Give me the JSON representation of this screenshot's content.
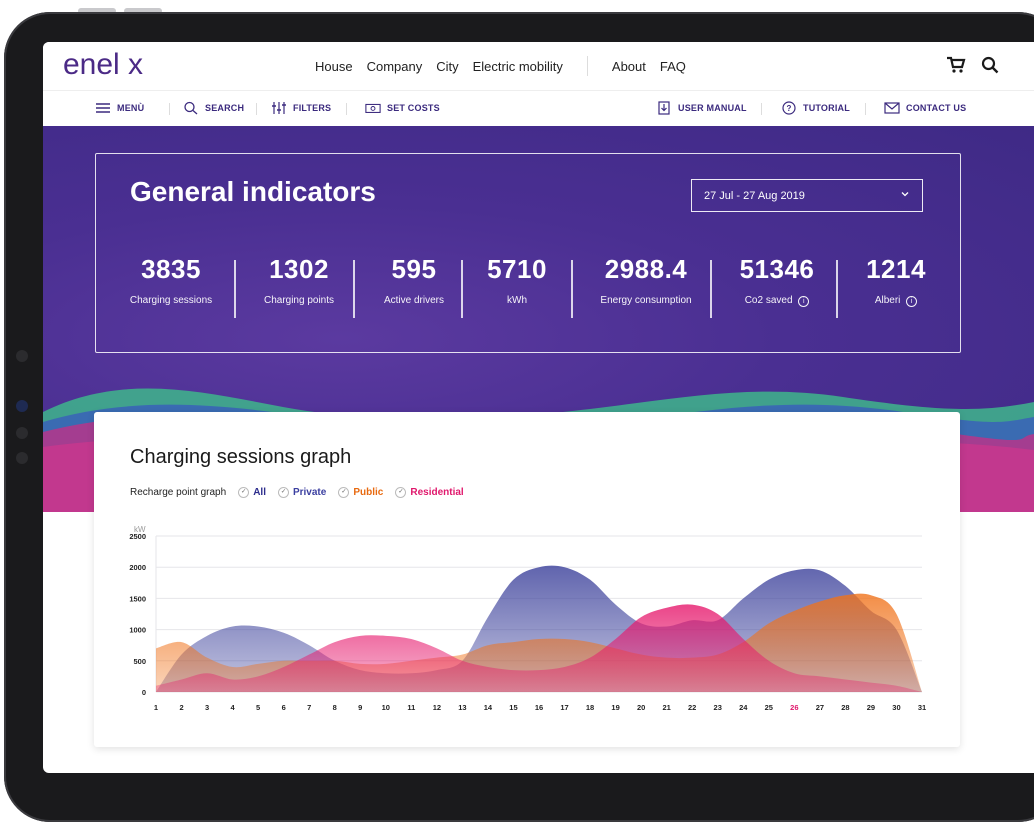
{
  "nav": {
    "logo": "enel x",
    "links": [
      "House",
      "Company",
      "City",
      "Electric mobility"
    ],
    "links2": [
      "About",
      "FAQ"
    ]
  },
  "toolbar": {
    "menu": "MENÙ",
    "search": "SEARCH",
    "filters": "FILTERS",
    "set_costs": "SET COSTS",
    "user_manual": "USER MANUAL",
    "tutorial": "TUTORIAL",
    "contact_us": "CONTACT US"
  },
  "indicators": {
    "title": "General indicators",
    "date_range": "27 Jul - 27 Aug 2019",
    "kpis": [
      {
        "value": "3835",
        "label": "Charging sessions"
      },
      {
        "value": "1302",
        "label": "Charging points"
      },
      {
        "value": "595",
        "label": "Active drivers"
      },
      {
        "value": "5710",
        "label": "kWh"
      },
      {
        "value": "2988.4",
        "label": "Energy consumption"
      },
      {
        "value": "51346",
        "label": "Co2 saved"
      },
      {
        "value": "1214",
        "label": "Alberi"
      }
    ]
  },
  "graph": {
    "title": "Charging sessions graph",
    "filter_label": "Recharge point graph",
    "filters": [
      {
        "label": "All",
        "color": "#2c2c8c"
      },
      {
        "label": "Private",
        "color": "#3b3fa0"
      },
      {
        "label": "Public",
        "color": "#e86a10"
      },
      {
        "label": "Residential",
        "color": "#e0186c"
      }
    ]
  },
  "colors": {
    "brand": "#4b2a86",
    "hero": "#4a2f92",
    "blue": "#3a3f9a",
    "orange": "#f0721a",
    "pink": "#e6186c",
    "highlight_day": "#e0186c"
  },
  "chart_data": {
    "type": "area",
    "ylabel": "kW",
    "ylim": [
      0,
      2500
    ],
    "yticks": [
      0,
      500,
      1000,
      1500,
      2000,
      2500
    ],
    "x": [
      1,
      2,
      3,
      4,
      5,
      6,
      7,
      8,
      9,
      10,
      11,
      12,
      13,
      14,
      15,
      16,
      17,
      18,
      19,
      20,
      21,
      22,
      23,
      24,
      25,
      26,
      27,
      28,
      29,
      30,
      31
    ],
    "highlight_x": 26,
    "grid": true,
    "series": [
      {
        "name": "Private",
        "color": "#3a3f9a",
        "values": [
          0,
          600,
          900,
          1050,
          1050,
          950,
          750,
          500,
          350,
          300,
          300,
          350,
          500,
          1200,
          1800,
          2000,
          2000,
          1800,
          1400,
          1100,
          1050,
          1150,
          1150,
          1500,
          1800,
          1950,
          1950,
          1700,
          1300,
          1000,
          0
        ]
      },
      {
        "name": "Public",
        "color": "#f0721a",
        "values": [
          700,
          800,
          550,
          400,
          450,
          500,
          500,
          500,
          450,
          450,
          500,
          550,
          600,
          750,
          800,
          850,
          850,
          800,
          700,
          600,
          550,
          550,
          600,
          800,
          1100,
          1300,
          1450,
          1550,
          1550,
          1250,
          0
        ]
      },
      {
        "name": "Residential",
        "color": "#e6186c",
        "values": [
          100,
          200,
          300,
          200,
          250,
          400,
          600,
          800,
          900,
          900,
          850,
          700,
          500,
          400,
          350,
          350,
          400,
          550,
          850,
          1200,
          1350,
          1400,
          1250,
          850,
          500,
          300,
          250,
          200,
          150,
          100,
          0
        ]
      }
    ]
  }
}
